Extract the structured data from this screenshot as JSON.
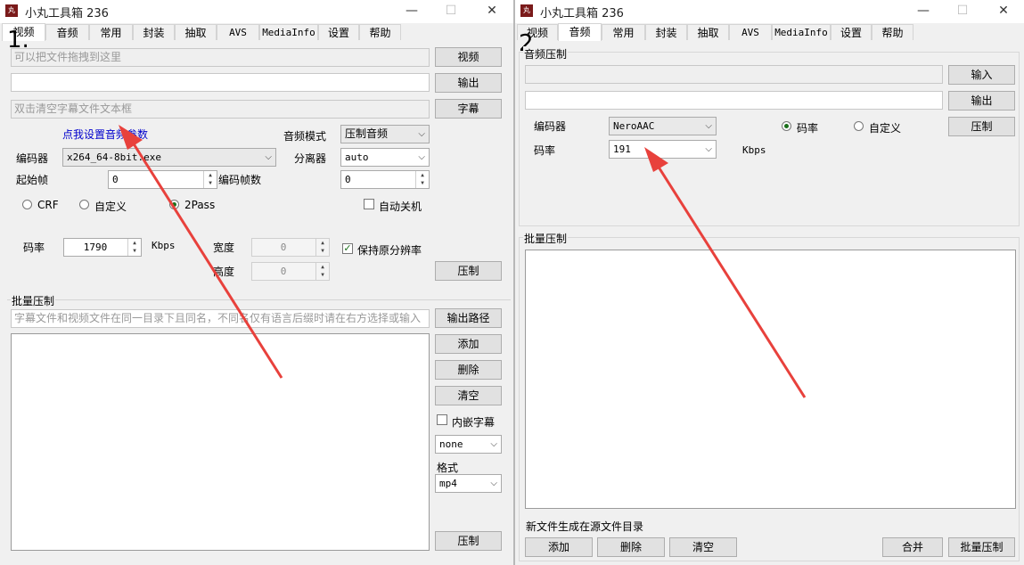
{
  "left_window": {
    "title": "小丸工具箱 236",
    "tabs": [
      "视频",
      "音频",
      "常用",
      "封装",
      "抽取",
      "AVS",
      "MediaInfo",
      "设置",
      "帮助"
    ],
    "step_label": "1.",
    "drop_hint": "可以把文件拖拽到这里",
    "video_button": "视频",
    "output_value": "",
    "output_button": "输出",
    "subtitle_hint": "双击清空字幕文件文本框",
    "subtitle_button": "字幕",
    "audio_settings_link": "点我设置音频参数",
    "audio_mode_label": "音频模式",
    "audio_mode_value": "压制音频",
    "encoder_label": "编码器",
    "encoder_value": "x264_64-8bit.exe",
    "splitter_label": "分离器",
    "splitter_value": "auto",
    "start_frame_label": "起始帧",
    "start_frame_value": "0",
    "encode_frames_label": "编码帧数",
    "encode_frames_value": "0",
    "radio_crf": "CRF",
    "radio_custom": "自定义",
    "radio_2pass": "2Pass",
    "auto_shutdown_label": "自动关机",
    "bitrate_label": "码率",
    "bitrate_value": "1790",
    "kbps": "Kbps",
    "width_label": "宽度",
    "width_value": "0",
    "height_label": "高度",
    "height_value": "0",
    "keep_resolution_label": "保持原分辨率",
    "encode_button": "压制",
    "batch_group": "批量压制",
    "batch_hint": "字幕文件和视频文件在同一目录下且同名，不同名仅有语言后缀时请在右方选择或输入",
    "output_path_button": "输出路径",
    "add_button": "添加",
    "delete_button": "删除",
    "clear_button": "清空",
    "embed_subtitle_label": "内嵌字幕",
    "subtitle_lang_value": "none",
    "format_label": "格式",
    "format_value": "mp4",
    "batch_encode_button": "压制"
  },
  "right_window": {
    "title": "小丸工具箱 236",
    "tabs": [
      "视频",
      "音频",
      "常用",
      "封装",
      "抽取",
      "AVS",
      "MediaInfo",
      "设置",
      "帮助"
    ],
    "step_label": "2",
    "audio_group": "音频压制",
    "input_value": "",
    "input_button": "输入",
    "output_value": "",
    "output_button": "输出",
    "encoder_label": "编码器",
    "encoder_value": "NeroAAC",
    "radio_bitrate": "码率",
    "radio_custom": "自定义",
    "encode_button": "压制",
    "bitrate_label": "码率",
    "bitrate_value": "191",
    "kbps": "Kbps",
    "batch_group": "批量压制",
    "new_file_note": "新文件生成在源文件目录",
    "add_button": "添加",
    "delete_button": "删除",
    "clear_button": "清空",
    "merge_button": "合并",
    "batch_encode_button": "批量压制"
  },
  "colors": {
    "arrow": "#e8413c",
    "link": "#0000cc",
    "window_bg": "#f0f0f0"
  },
  "icons": [
    "app-icon",
    "minimize-icon",
    "maximize-icon",
    "close-icon",
    "dropdown-arrow-icon",
    "spinner-icon",
    "checkmark-icon",
    "red-arrow-icon"
  ]
}
